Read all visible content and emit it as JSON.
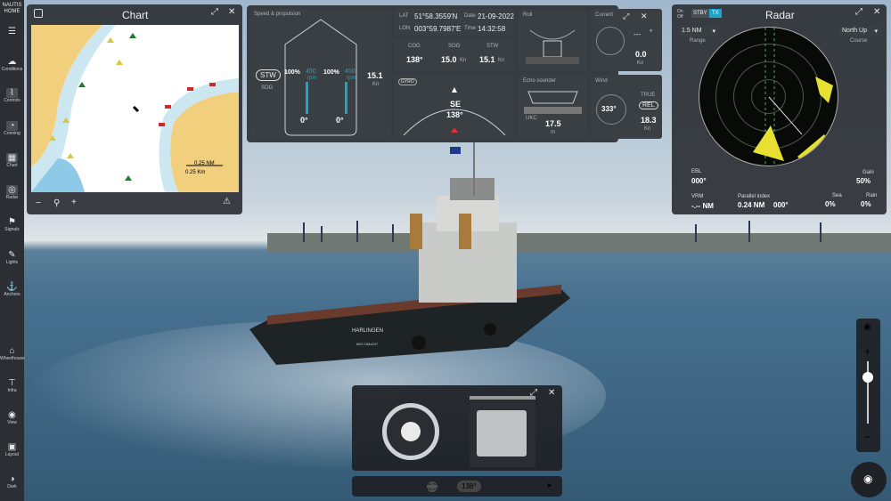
{
  "sidebar": {
    "logo": "NAUTIS HOME",
    "items": [
      {
        "label": "Conditions",
        "icon": "cloud-icon"
      },
      {
        "label": "Controls",
        "icon": "controls-icon"
      },
      {
        "label": "Conning",
        "icon": "conning-icon"
      },
      {
        "label": "Chart",
        "icon": "chart-grid-icon"
      },
      {
        "label": "Radar",
        "icon": "radar-icon"
      },
      {
        "label": "Signals",
        "icon": "flag-icon"
      },
      {
        "label": "Lights",
        "icon": "light-icon"
      },
      {
        "label": "Anchors",
        "icon": "anchor-icon"
      },
      {
        "label": "Wheelhouse",
        "icon": "wheelhouse-icon"
      },
      {
        "label": "Infra",
        "icon": "crane-icon"
      },
      {
        "label": "View",
        "icon": "eye-icon"
      },
      {
        "label": "Layout",
        "icon": "layout-icon"
      },
      {
        "label": "Dark",
        "icon": "contrast-icon"
      }
    ]
  },
  "chart_panel": {
    "title": "Chart",
    "scale_label": "0.25 NM",
    "scale_label2": "0.25 Km"
  },
  "conning": {
    "speed_propulsion": "Speed & propulsion",
    "stw_btn": "STW",
    "sog_label": "SOG",
    "left_pct": "100%",
    "left_rpm": "450",
    "rpm_unit": "rpm",
    "left_deg": "0°",
    "right_pct": "100%",
    "right_rpm": "450",
    "right_deg": "0°",
    "speed": "15.1",
    "speed_unit": "Kn",
    "lat_label": "LAT",
    "lat": "51°58.3559'N",
    "date_label": "Date",
    "date": "21-09-2022",
    "lon_label": "LON",
    "lon": "003°59.7987'E",
    "time_label": "Time",
    "time": "14:32:58",
    "cog_label": "COG",
    "cog": "138°",
    "sog2_label": "SOG",
    "sog2": "15.0",
    "sog2_unit": "Kn",
    "stw_label": "STW",
    "stw": "15.1",
    "stw_unit": "Kn",
    "gyro_label": "GYRO",
    "heading_dir": "SE",
    "heading": "138°",
    "roll_label": "Roll",
    "current_label": "Current",
    "current_dash": "---",
    "current_unit": "°",
    "current_speed": "0.0",
    "current_speed_unit": "Kn",
    "echo_label": "Echo sounder",
    "ukc_label": "UKC",
    "depth": "17.5",
    "depth_unit": "m",
    "wind_label": "Wind",
    "wind_true": "TRUE",
    "wind_rel_btn": "REL",
    "wind_dir": "333°",
    "wind_speed": "18.3",
    "wind_unit": "Kn"
  },
  "radar": {
    "onoff": "On Off",
    "stby": "STBY",
    "tx": "TX",
    "title": "Radar",
    "range_value": "1.5 NM",
    "range_label": "Range",
    "course_value": "North Up",
    "course_label": "Course",
    "ebl_label": "EBL",
    "ebl": "000°",
    "vrm_label": "VRM",
    "vrm": "-.-- NM",
    "parallel_label": "Parallel index",
    "parallel_nm": "0.24 NM",
    "parallel_deg": "000°",
    "gain_label": "Gain",
    "gain": "50%",
    "sea_label": "Sea",
    "sea": "0%",
    "rain_label": "Rain",
    "rain": "0%"
  },
  "controls_panel": {
    "autopilot": "AUTO PILOT",
    "heading": "138°"
  },
  "boat": {
    "name": "HARLINGEN",
    "imo": "IMO 1584247"
  },
  "colors": {
    "panel": "#2e3237",
    "accent": "#1fa3c7",
    "arrow": "#e03030"
  }
}
